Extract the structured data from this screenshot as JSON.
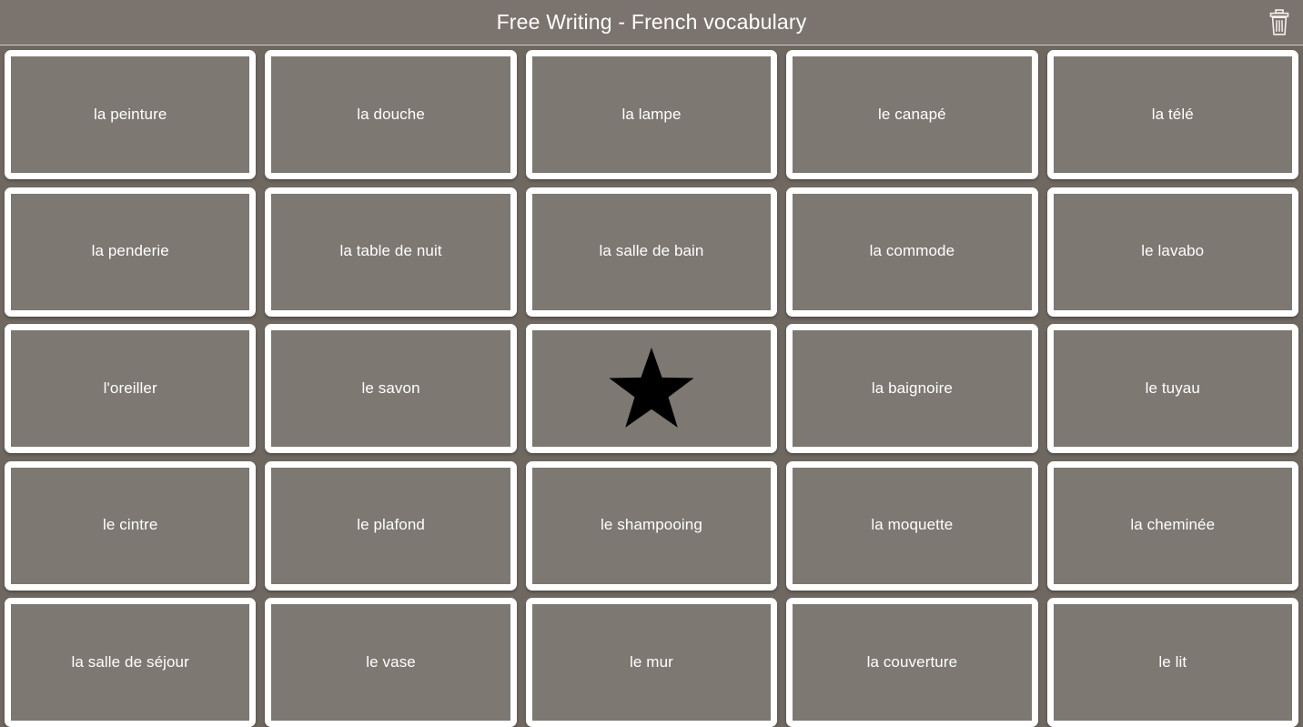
{
  "header": {
    "title": "Free Writing - French vocabulary",
    "trash_icon": "trash-icon",
    "background_color": "#7b746e",
    "title_color": "#ffffff"
  },
  "theme": {
    "page_background": "#6f6861",
    "card_fill": "#7d7872",
    "card_border": "#ffffff",
    "card_text": "#ffffff",
    "star_color": "#000000"
  },
  "grid": {
    "columns": 5,
    "rows": 5,
    "cards": [
      {
        "label": "la peinture",
        "type": "text"
      },
      {
        "label": "la douche",
        "type": "text"
      },
      {
        "label": "la lampe",
        "type": "text"
      },
      {
        "label": "le canapé",
        "type": "text"
      },
      {
        "label": "la télé",
        "type": "text"
      },
      {
        "label": "la penderie",
        "type": "text"
      },
      {
        "label": "la table de nuit",
        "type": "text"
      },
      {
        "label": "la salle de bain",
        "type": "text"
      },
      {
        "label": "la commode",
        "type": "text"
      },
      {
        "label": "le lavabo",
        "type": "text"
      },
      {
        "label": "l'oreiller",
        "type": "text"
      },
      {
        "label": "le savon",
        "type": "text"
      },
      {
        "label": "",
        "type": "star",
        "icon": "star-icon"
      },
      {
        "label": "la baignoire",
        "type": "text"
      },
      {
        "label": "le tuyau",
        "type": "text"
      },
      {
        "label": "le cintre",
        "type": "text"
      },
      {
        "label": "le plafond",
        "type": "text"
      },
      {
        "label": "le shampooing",
        "type": "text"
      },
      {
        "label": "la moquette",
        "type": "text"
      },
      {
        "label": "la cheminée",
        "type": "text"
      },
      {
        "label": "la salle de séjour",
        "type": "text"
      },
      {
        "label": "le vase",
        "type": "text"
      },
      {
        "label": "le mur",
        "type": "text"
      },
      {
        "label": "la couverture",
        "type": "text"
      },
      {
        "label": "le lit",
        "type": "text"
      }
    ]
  }
}
